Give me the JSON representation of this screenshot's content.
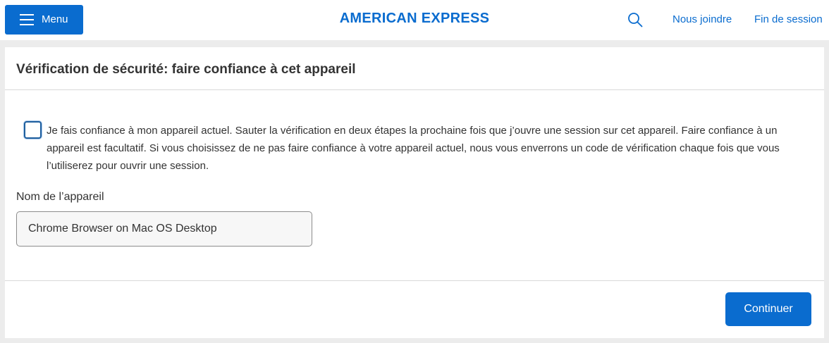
{
  "header": {
    "menu_label": "Menu",
    "brand": "AMERICAN EXPRESS",
    "nav": {
      "contact": "Nous joindre",
      "logout": "Fin de session"
    }
  },
  "card": {
    "title": "Vérification de sécurité: faire confiance à cet appareil",
    "trust_checkbox": {
      "checked": false,
      "text": "Je fais confiance à mon appareil actuel. Sauter la vérification en deux étapes la prochaine fois que j’ouvre une session sur cet appareil. Faire confiance à un appareil est facultatif. Si vous choisissez de ne pas faire confiance à votre appareil actuel, nous vous enverrons un code de vérification chaque fois que vous l’utiliserez pour ouvrir une session."
    },
    "device_name": {
      "label": "Nom de l’appareil",
      "value": "Chrome Browser on Mac OS Desktop"
    },
    "continue_label": "Continuer"
  },
  "colors": {
    "accent": "#0a6ccf",
    "background": "#ececec",
    "text": "#333333",
    "divider": "#d9d9d9"
  },
  "icons": {
    "menu": "hamburger-icon",
    "search": "search-icon"
  }
}
